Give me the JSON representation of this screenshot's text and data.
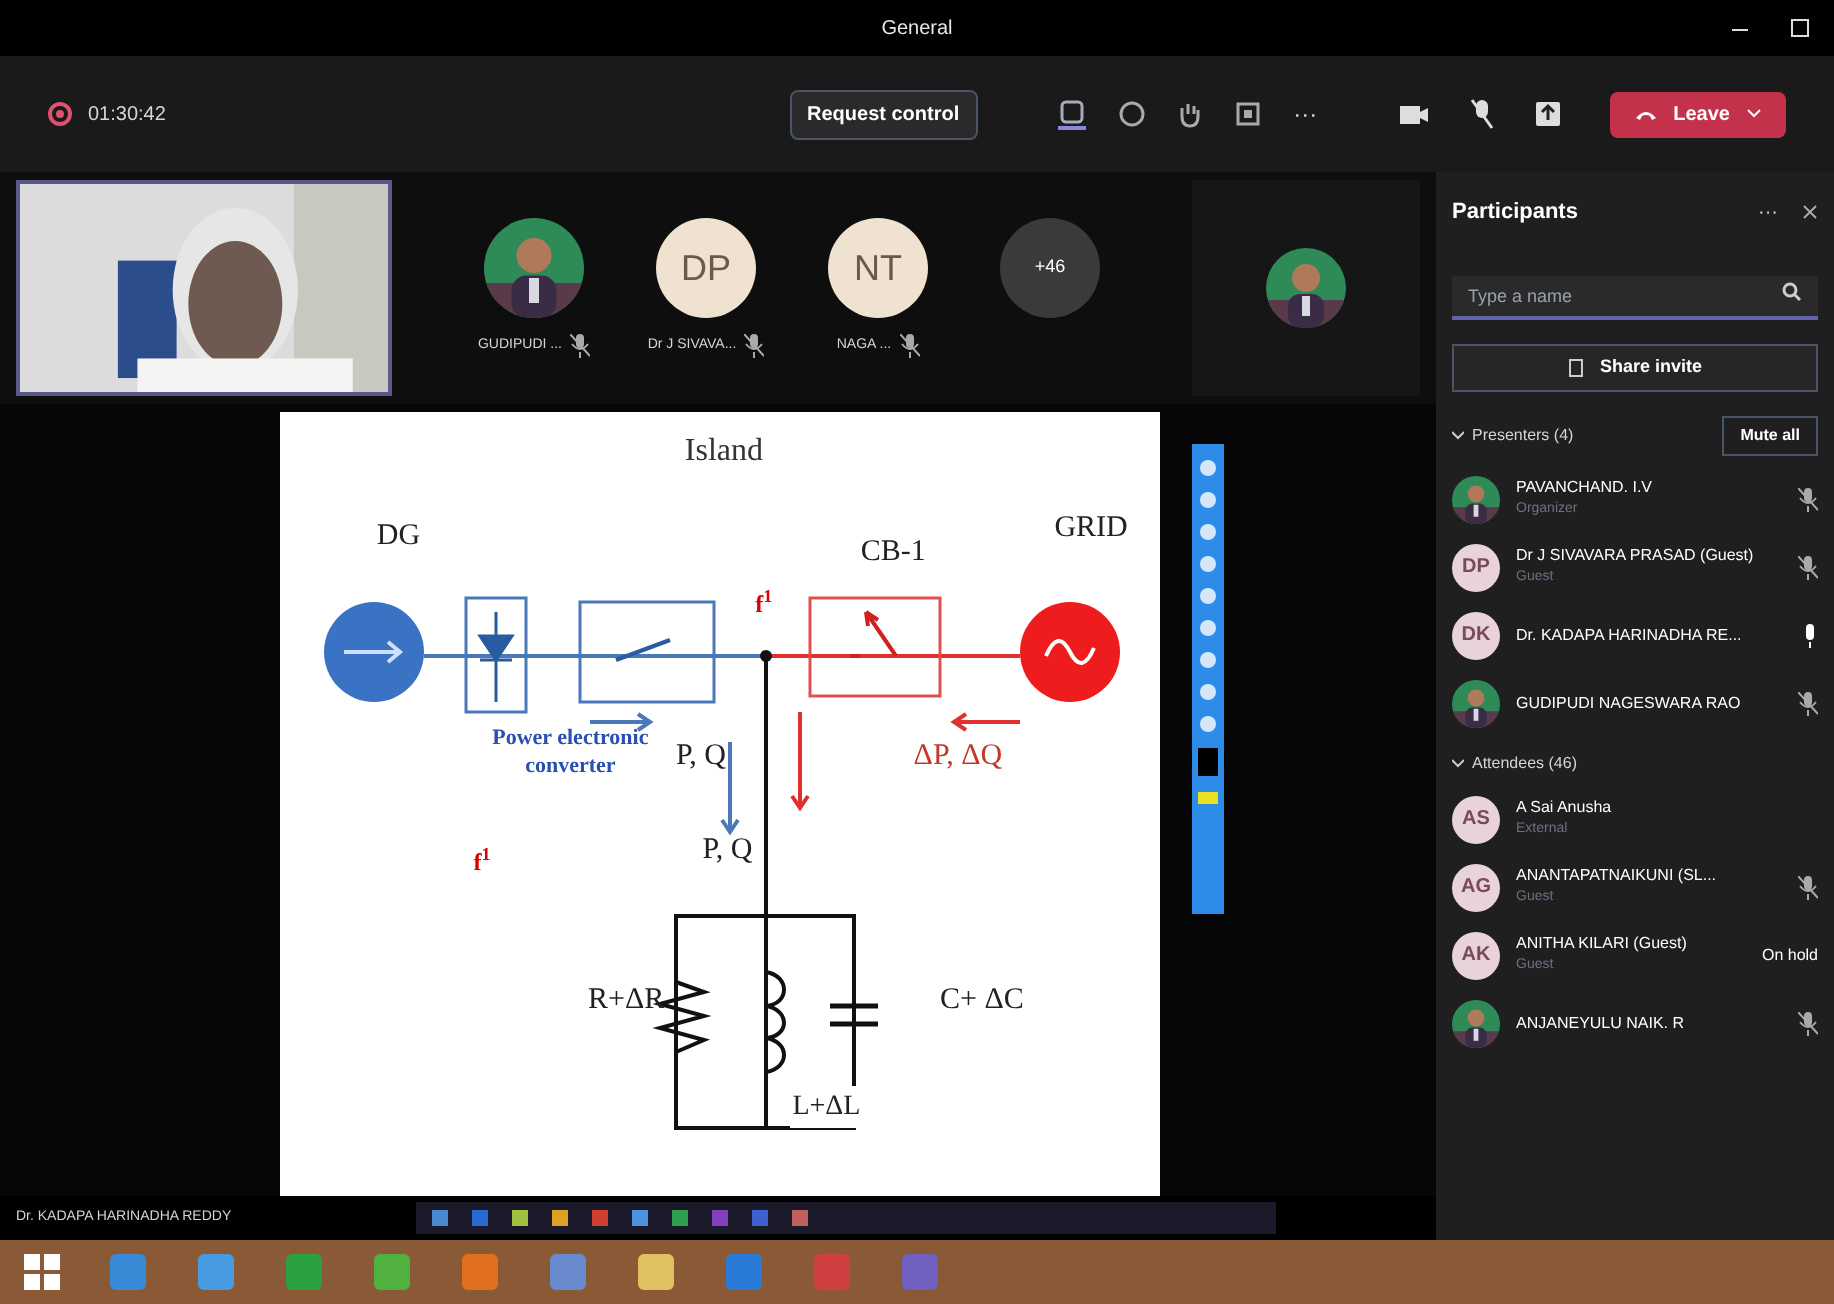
{
  "window": {
    "title": "General"
  },
  "toolbar": {
    "timer": "01:30:42",
    "request_button": "Request control",
    "more": "···",
    "leave_button": "Leave"
  },
  "attendee_strip": [
    {
      "name": "GUDIPUDI ..."
    },
    {
      "kind": "initials",
      "initials": "DP",
      "name": "Dr J SIVAVA..."
    },
    {
      "kind": "initials",
      "initials": "NT",
      "name": "NAGA ..."
    },
    {
      "kind": "overflow",
      "count": "+46"
    }
  ],
  "slide": {
    "title": "Island",
    "labels": [
      "DG",
      "GRID",
      "CB-1",
      "f$^{1}$",
      "Power electronic converter",
      "P, Q",
      "ΔP, ΔQ",
      "P, Q",
      "f$^{1}$",
      "R+ΔR",
      "L+ΔL",
      "C+ ΔC"
    ]
  },
  "presenter_name": "Dr. KADAPA HARINADHA REDDY",
  "participants": {
    "title": "Participants",
    "more": "···",
    "search": {
      "placeholder": "Type a name"
    },
    "share_button": "Share invite",
    "sections": [
      {
        "title": "Presenters (4)",
        "action": "Mute all",
        "expanded": true,
        "people": [
          {
            "name": "PAVANCHAND. I.V",
            "role": "Organizer",
            "mic_muted": true
          },
          {
            "initials": "DP",
            "name": "Dr J SIVAVARA PRASAD (Guest)",
            "role": "Guest",
            "mic_muted": true
          },
          {
            "initials": "DK",
            "name": "Dr. KADAPA HARINADHA RE...",
            "mic_muted": false
          },
          {
            "name": "GUDIPUDI NAGESWARA RAO",
            "mic_muted": true
          }
        ]
      },
      {
        "title": "Attendees (46)",
        "expanded": true,
        "people": [
          {
            "initials": "AS",
            "name": "A Sai Anusha",
            "role": "External"
          },
          {
            "initials": "AG",
            "name": "ANANTAPATNAIKUNI (SL...",
            "role": "Guest",
            "mic_muted": true
          },
          {
            "initials": "AK",
            "name": "ANITHA KILARI (Guest)",
            "role": "Guest",
            "note": "On hold"
          },
          {
            "name": "ANJANEYULU NAIK. R",
            "mic_muted": true
          }
        ]
      }
    ]
  }
}
